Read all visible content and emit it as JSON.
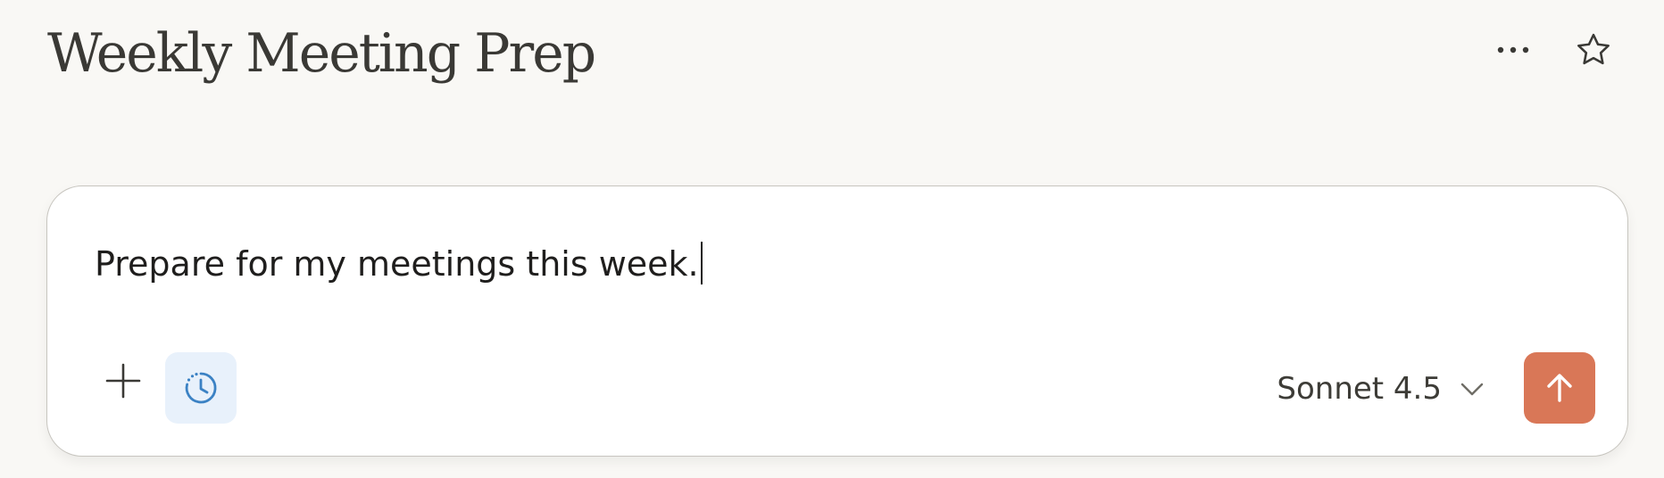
{
  "header": {
    "title": "Weekly Meeting Prep",
    "more_icon": "more-horizontal-icon",
    "star_icon": "star-outline-icon"
  },
  "composer": {
    "input_value": "Prepare for my meetings this week.",
    "add_icon": "plus-icon",
    "schedule_icon": "clock-schedule-icon",
    "model": {
      "selected": "Sonnet 4.5",
      "chevron_icon": "chevron-down-icon"
    },
    "send_icon": "arrow-up-icon"
  },
  "colors": {
    "background": "#f9f8f5",
    "title": "#3a3935",
    "send_button": "#d97757",
    "schedule_button_bg": "#e8f1fb",
    "schedule_icon": "#3b82c4"
  }
}
